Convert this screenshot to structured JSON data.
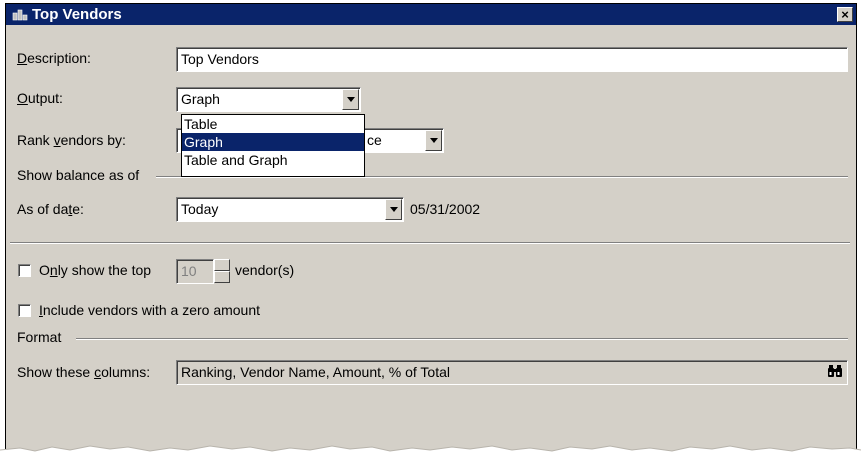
{
  "window": {
    "title": "Top Vendors",
    "close_label": "×",
    "title_icon": "report-icon"
  },
  "description": {
    "label_pre": "",
    "label_accel": "D",
    "label_post": "escription:",
    "value": "Top Vendors"
  },
  "output": {
    "label_accel": "O",
    "label_post": "utput:",
    "value": "Graph",
    "options": [
      "Table",
      "Graph",
      "Table and Graph"
    ],
    "highlighted": "Graph"
  },
  "rank": {
    "label_pre": "Rank ",
    "label_accel": "v",
    "label_post": "endors by:",
    "value_visible": "ce"
  },
  "balance_section": {
    "title": "Show balance as of"
  },
  "as_of": {
    "label_pre": "As of da",
    "label_accel": "t",
    "label_post": "e:",
    "value": "Today",
    "date": "05/31/2002"
  },
  "only_top": {
    "checked": false,
    "label_pre": "O",
    "label_accel": "n",
    "label_post": "ly show the top",
    "count": "10",
    "suffix": "vendor(s)"
  },
  "include_zero": {
    "checked": false,
    "label_accel": "I",
    "label_post": "nclude vendors with a zero amount"
  },
  "format_section": {
    "title": "Format"
  },
  "columns": {
    "label_pre": "Show these ",
    "label_accel": "c",
    "label_post": "olumns:",
    "value": "Ranking, Vendor Name, Amount, % of Total",
    "button_icon": "binoculars-icon"
  },
  "colors": {
    "titlebar": "#0a246a",
    "face": "#d4d0c8",
    "highlight": "#0a246a"
  }
}
